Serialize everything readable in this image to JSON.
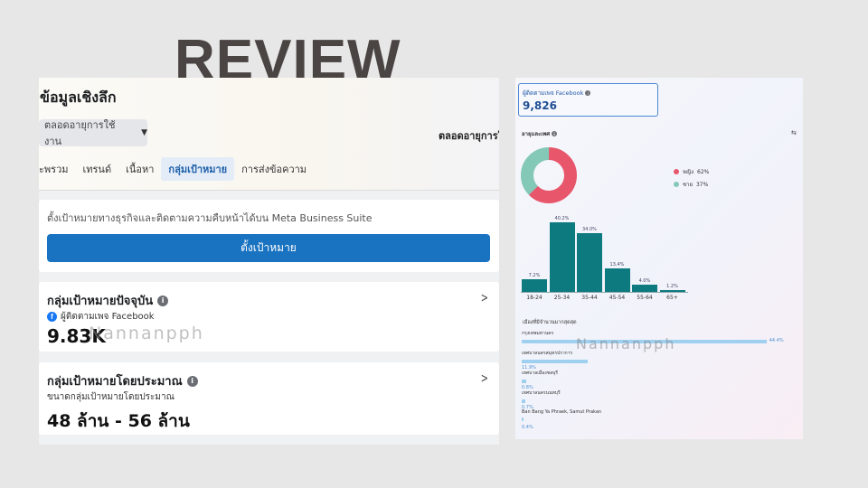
{
  "overlay_title": "REVIEW",
  "left_panel": {
    "title": "ข้อมูลเชิงลึก",
    "dropdown_label": "ตลอดอายุการใช้งาน",
    "period_label": "ตลอดอายุการใช้",
    "tabs": [
      "ภาพรวม",
      "เทรนด์",
      "เนื้อหา",
      "กลุ่มเป้าหมาย",
      "การส่งข้อความ"
    ],
    "tabs_visible": [
      "ะพรวม",
      "เทรนด์",
      "เนื้อหา",
      "กลุ่มเป้าหมาย",
      "การส่งข้อความ"
    ],
    "active_tab": "กลุ่มเป้าหมาย",
    "goal_card": {
      "text": "ตั้งเป้าหมายทางธุรกิจและติดตามความคืบหน้าได้บน Meta Business Suite",
      "button_label": "ตั้งเป้าหมาย"
    },
    "current_audience": {
      "title": "กลุ่มเป้าหมายปัจจุบัน",
      "source_label": "ผู้ติดตามเพจ Facebook",
      "value": "9.83K",
      "watermark": "Nannanpph"
    },
    "estimated_audience": {
      "title": "กลุ่มเป้าหมายโดยประมาณ",
      "subtitle": "ขนาดกลุ่มเป้าหมายโดยประมาณ",
      "value": "48 ล้าน - 56 ล้าน"
    }
  },
  "right_panel": {
    "followers_label": "ผู้ติดตามเพจ Facebook",
    "followers_value": "9,826",
    "age_gender_title": "อายุและเพศ",
    "gender": [
      {
        "label": "หญิง",
        "percent_text": "62%",
        "value": 62,
        "color": "#e8566b"
      },
      {
        "label": "ชาย",
        "percent_text": "37%",
        "value": 37,
        "color": "#84c8b8"
      }
    ],
    "cities_title": "เมืองที่มีจำนวนมากสุดสุด",
    "cities": [
      {
        "name": "กรุงเทพมหานคร",
        "percent_text": "44.4%",
        "value": 44.4
      },
      {
        "name": "เทศบาลนครสมุทรปราการ",
        "percent_text": "11.9%",
        "value": 11.9
      },
      {
        "name": "เทศบาลเมืองชลบุรี",
        "percent_text": "0.8%",
        "value": 0.8
      },
      {
        "name": "เทศบาลนครนนทบุรี",
        "percent_text": "0.7%",
        "value": 0.7
      },
      {
        "name": "Ban Bang Ya Phraek, Samut Prakan",
        "percent_text": "0.4%",
        "value": 0.4
      }
    ],
    "watermark": "Nannanpph"
  },
  "chart_data": {
    "type": "bar",
    "categories": [
      "18-24",
      "25-34",
      "35-44",
      "45-54",
      "55-64",
      "65+"
    ],
    "values": [
      7.2,
      40.2,
      34.0,
      13.4,
      4.0,
      1.2
    ],
    "value_labels": [
      "7.2%",
      "40.2%",
      "34.0%",
      "13.4%",
      "4.0%",
      "1.2%"
    ],
    "ylim": [
      0,
      42
    ],
    "bar_color": "#0d7a7f"
  }
}
